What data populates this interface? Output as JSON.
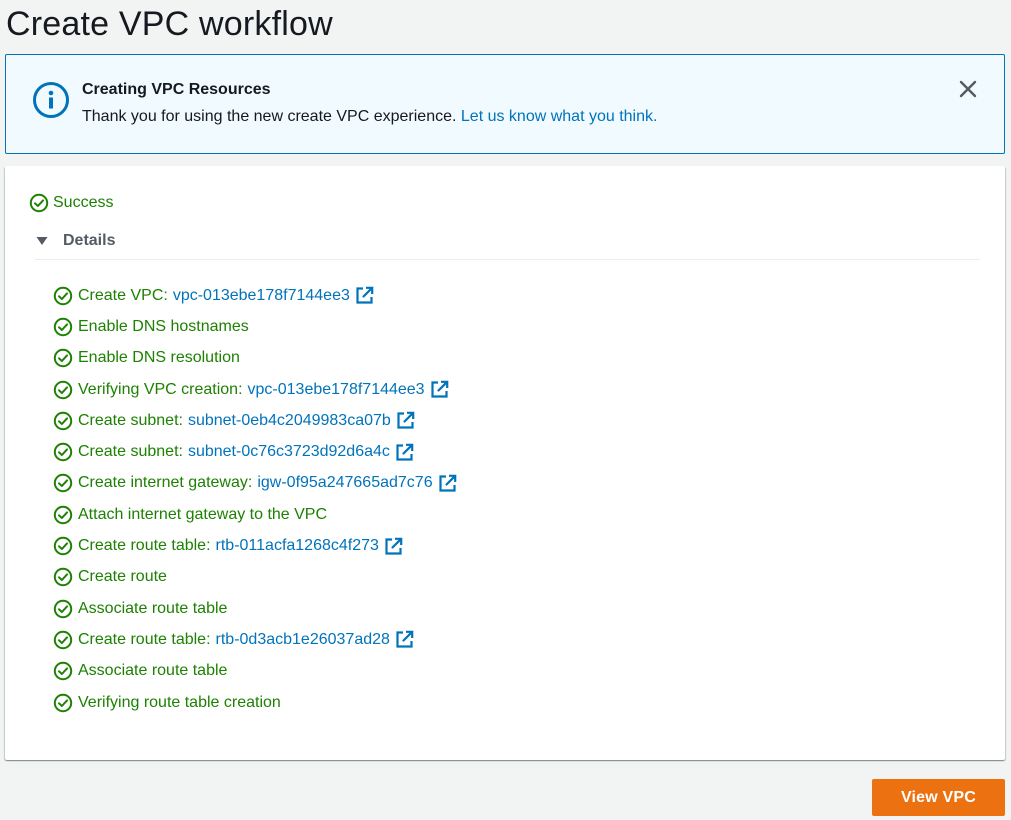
{
  "page": {
    "title": "Create VPC workflow"
  },
  "flash": {
    "title": "Creating VPC Resources",
    "message": "Thank you for using the new create VPC experience.",
    "link": "Let us know what you think.",
    "icon": "info-icon",
    "close_icon": "close-icon",
    "color": "#0073bb"
  },
  "status": {
    "label": "Success",
    "icon": "check-circle-icon",
    "color": "#1d8102"
  },
  "details": {
    "label": "Details",
    "expanded": true,
    "icon": "caret-down-icon",
    "steps": [
      {
        "label": "Create VPC:",
        "link": "vpc-013ebe178f7144ee3"
      },
      {
        "label": "Enable DNS hostnames",
        "link": ""
      },
      {
        "label": "Enable DNS resolution",
        "link": ""
      },
      {
        "label": "Verifying VPC creation:",
        "link": "vpc-013ebe178f7144ee3"
      },
      {
        "label": "Create subnet:",
        "link": "subnet-0eb4c2049983ca07b"
      },
      {
        "label": "Create subnet:",
        "link": "subnet-0c76c3723d92d6a4c"
      },
      {
        "label": "Create internet gateway:",
        "link": "igw-0f95a247665ad7c76"
      },
      {
        "label": "Attach internet gateway to the VPC",
        "link": ""
      },
      {
        "label": "Create route table:",
        "link": "rtb-011acfa1268c4f273"
      },
      {
        "label": "Create route",
        "link": ""
      },
      {
        "label": "Associate route table",
        "link": ""
      },
      {
        "label": "Create route table:",
        "link": "rtb-0d3acb1e26037ad28"
      },
      {
        "label": "Associate route table",
        "link": ""
      },
      {
        "label": "Verifying route table creation",
        "link": ""
      }
    ]
  },
  "actions": {
    "view_vpc": "View VPC",
    "color": "#ec7211"
  },
  "link_color": "#0073bb"
}
